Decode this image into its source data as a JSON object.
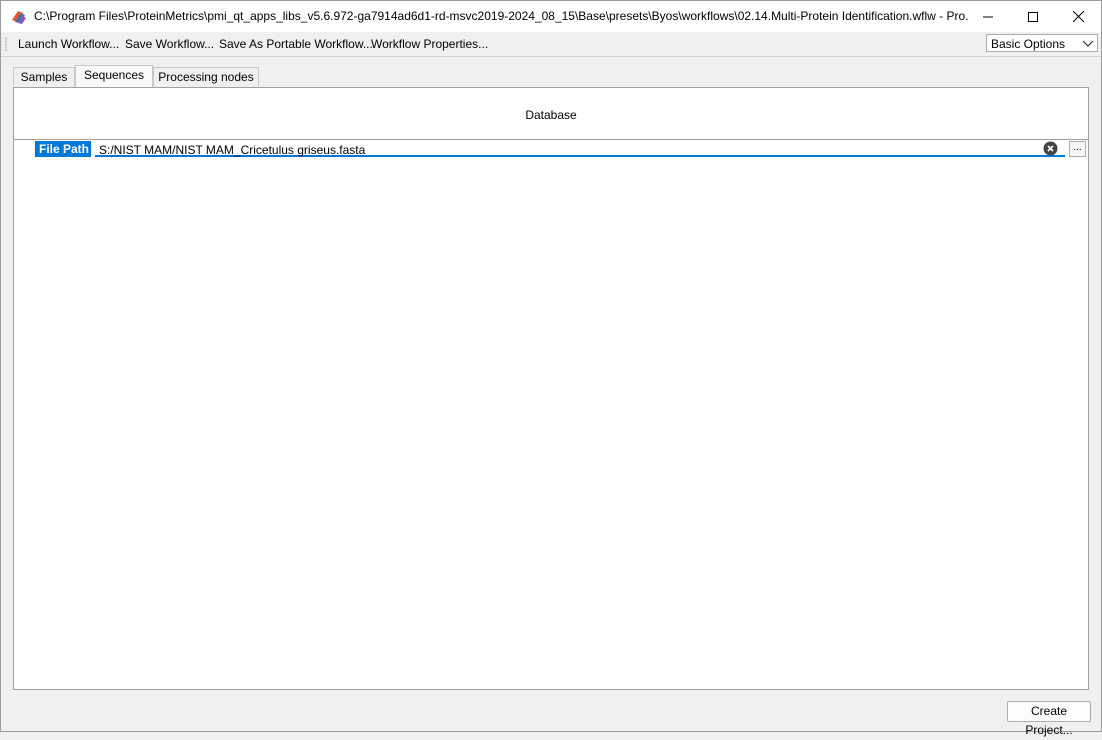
{
  "window": {
    "title": "C:\\Program Files\\ProteinMetrics\\pmi_qt_apps_libs_v5.6.972-ga7914ad6d1-rd-msvc2019-2024_08_15\\Base\\presets\\Byos\\workflows\\02.14.Multi-Protein Identification.wflw - Pro...",
    "icon": "app-icon",
    "controls": [
      "minimize-icon",
      "maximize-icon",
      "close-icon"
    ]
  },
  "toolbar": {
    "launch_label": "Launch Workflow...",
    "save_label": "Save Workflow...",
    "save_portable_label": "Save As Portable Workflow...",
    "properties_label": "Workflow Properties...",
    "options_selected": "Basic Options"
  },
  "tabs": [
    {
      "label": "Samples",
      "active": false
    },
    {
      "label": "Sequences",
      "active": true
    },
    {
      "label": "Processing nodes",
      "active": false
    }
  ],
  "database": {
    "title": "Database",
    "file_path_label": "File Path",
    "file_path_value": "S:/NIST MAM/NIST MAM_Cricetulus griseus.fasta",
    "browse_label": "..."
  },
  "footer": {
    "create_project_label": "Create Project..."
  },
  "colors": {
    "accent": "#0078d7",
    "window_bg": "#f0f0f0",
    "pane_bg": "#ffffff"
  }
}
